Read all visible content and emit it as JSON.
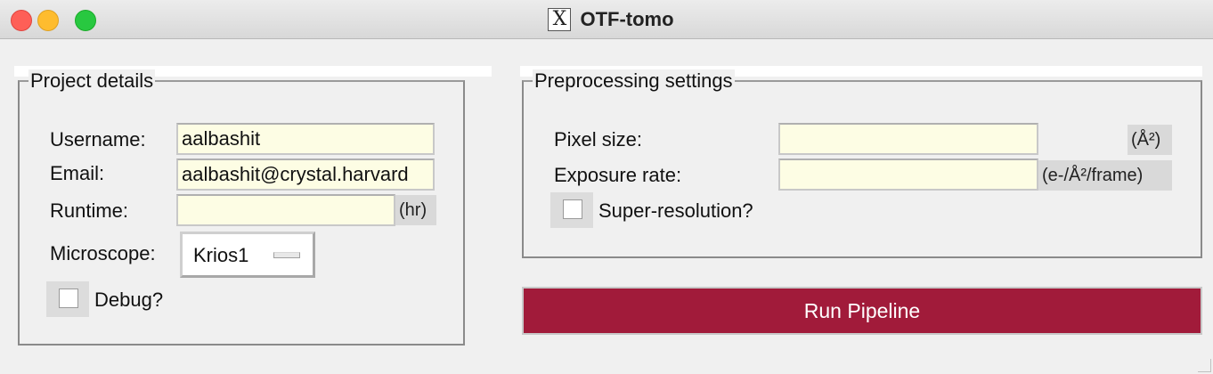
{
  "window": {
    "title": "OTF-tomo",
    "title_icon": "X"
  },
  "project": {
    "legend": "Project details",
    "username_label": "Username:",
    "username_value": "aalbashit",
    "email_label": "Email:",
    "email_value": "aalbashit@crystal.harvard",
    "runtime_label": "Runtime:",
    "runtime_value": "",
    "runtime_unit": "(hr)",
    "microscope_label": "Microscope:",
    "microscope_value": "Krios1",
    "debug_label": "Debug?",
    "debug_checked": false
  },
  "preprocessing": {
    "legend": "Preprocessing settings",
    "pixel_size_label": "Pixel size:",
    "pixel_size_value": "",
    "pixel_size_unit": "(Å²)",
    "exposure_rate_label": "Exposure rate:",
    "exposure_rate_value": "",
    "exposure_rate_unit": "(e-/Å²/frame)",
    "superres_label": "Super-resolution?",
    "superres_checked": false
  },
  "actions": {
    "run_label": "Run Pipeline"
  },
  "colors": {
    "run_button_bg": "#a11b3a",
    "field_bg": "#fdfde4"
  },
  "icons": {
    "close": "close-icon",
    "minimize": "minimize-icon",
    "maximize": "maximize-icon",
    "app": "x11-icon"
  }
}
